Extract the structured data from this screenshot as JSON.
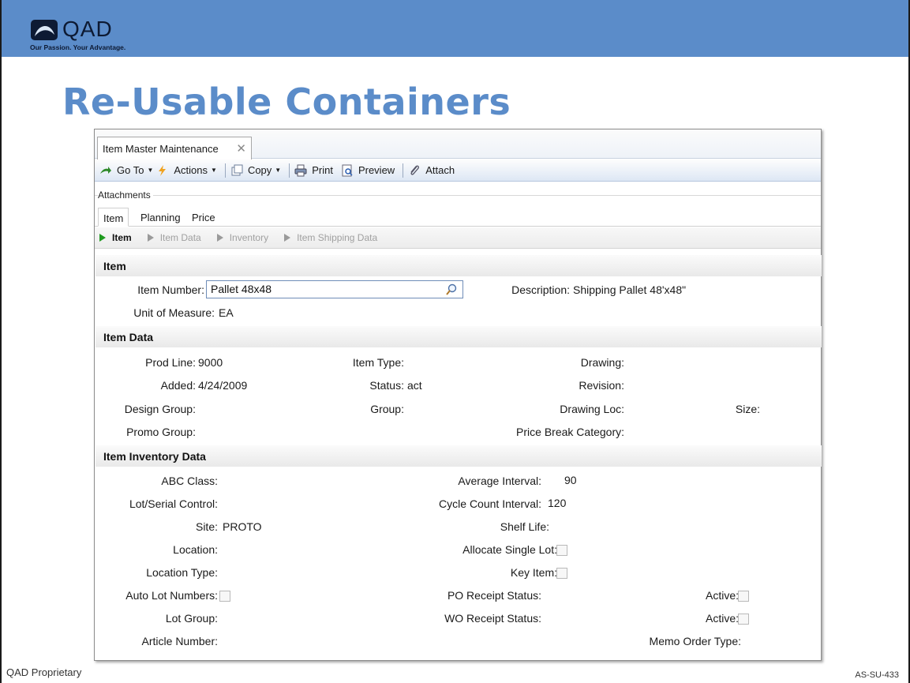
{
  "slide": {
    "logo_text": "QAD",
    "logo_tagline": "Our Passion. Your Advantage.",
    "title": "Re-Usable Containers",
    "footer_left": "QAD Proprietary",
    "footer_right": "AS-SU-433"
  },
  "colors": {
    "banner": "#5b8cc9",
    "title": "#5b8cc9",
    "active_crumb": "#1f9a1f"
  },
  "window": {
    "tab_label": "Item Master Maintenance",
    "tab_close": "✕"
  },
  "toolbar": {
    "goto": "Go To",
    "actions": "Actions",
    "copy": "Copy",
    "print": "Print",
    "preview": "Preview",
    "attach": "Attach"
  },
  "attachments_label": "Attachments",
  "subtabs": [
    "Item",
    "Planning",
    "Price"
  ],
  "crumbs": [
    "Item",
    "Item Data",
    "Inventory",
    "Item Shipping Data"
  ],
  "sections": {
    "item": "Item",
    "item_data": "Item Data",
    "item_inventory": "Item Inventory Data"
  },
  "item": {
    "item_number_label": "Item Number:",
    "item_number_value": "Pallet 48x48",
    "description_label": "Description:",
    "description_value": "Shipping Pallet 48'x48\"",
    "uom_label": "Unit of Measure:",
    "uom_value": "EA"
  },
  "item_data": {
    "prod_line_label": "Prod Line:",
    "prod_line_value": "9000",
    "item_type_label": "Item Type:",
    "drawing_label": "Drawing:",
    "added_label": "Added:",
    "added_value": "4/24/2009",
    "status_label": "Status:",
    "status_value": "act",
    "revision_label": "Revision:",
    "design_group_label": "Design Group:",
    "group_label": "Group:",
    "drawing_loc_label": "Drawing Loc:",
    "size_label": "Size:",
    "promo_group_label": "Promo Group:",
    "price_break_label": "Price Break Category:"
  },
  "inventory": {
    "abc_label": "ABC Class:",
    "avg_interval_label": "Average Interval:",
    "avg_interval_value": "90",
    "lot_serial_label": "Lot/Serial Control:",
    "cycle_count_label": "Cycle Count Interval:",
    "cycle_count_value": "120",
    "site_label": "Site:",
    "site_value": "PROTO",
    "shelf_life_label": "Shelf Life:",
    "location_label": "Location:",
    "alloc_single_lot_label": "Allocate Single Lot:",
    "location_type_label": "Location Type:",
    "key_item_label": "Key Item:",
    "auto_lot_label": "Auto Lot Numbers:",
    "po_receipt_label": "PO Receipt Status:",
    "active1_label": "Active:",
    "lot_group_label": "Lot Group:",
    "wo_receipt_label": "WO Receipt Status:",
    "active2_label": "Active:",
    "article_label": "Article Number:",
    "memo_order_label": "Memo Order Type:"
  }
}
